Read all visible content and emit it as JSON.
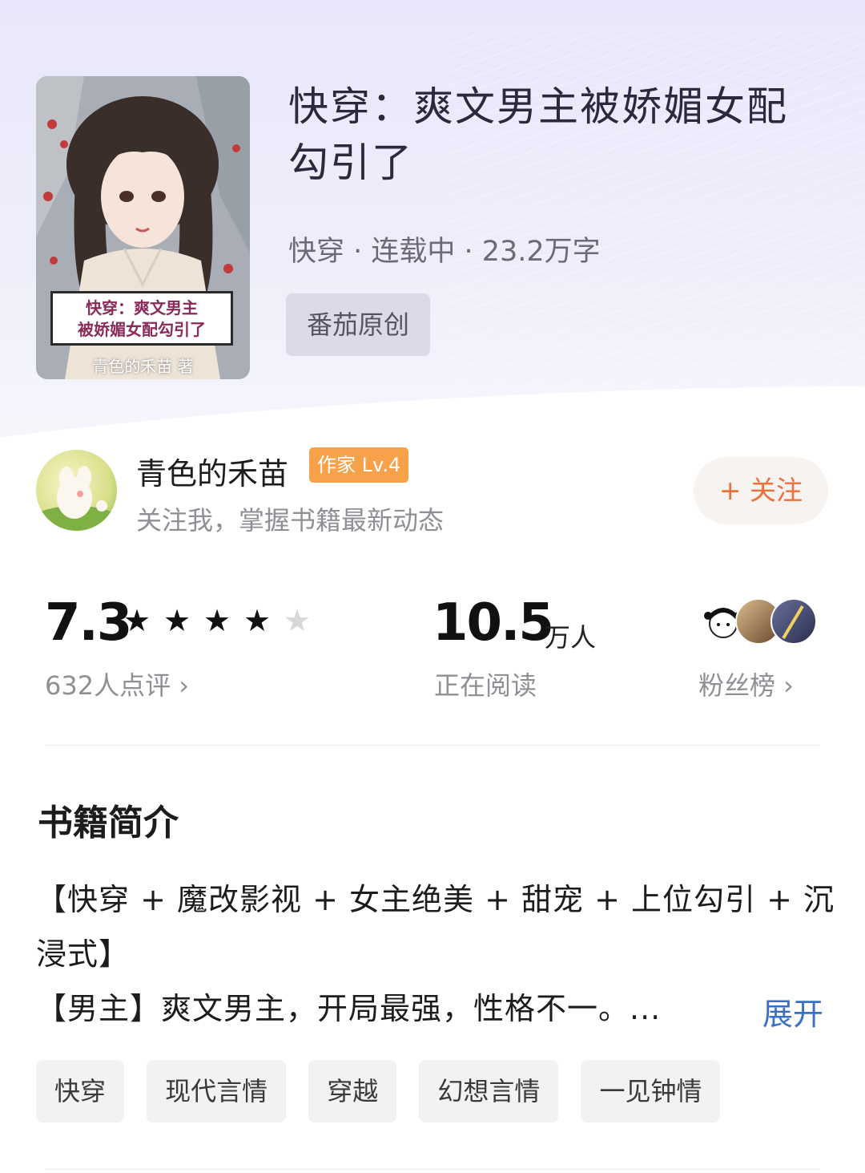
{
  "book": {
    "title": "快穿：爽文男主被娇媚女配勾引了",
    "meta": "快穿 · 连载中 · 23.2万字",
    "origin_badge": "番茄原创",
    "cover": {
      "label_line1": "快穿：爽文男主",
      "label_line2": "被娇媚女配勾引了",
      "author_text": "青色的禾苗 著"
    }
  },
  "author": {
    "name": "青色的禾苗",
    "level": "作家 Lv.4",
    "tip": "关注我，掌握书籍最新动态",
    "follow_label": "+ 关注"
  },
  "stats": {
    "rating": "7.3",
    "stars": 4,
    "star_total": 5,
    "rating_count": "632人点评 ›",
    "reading_value": "10.5",
    "reading_unit": "万人",
    "reading_label": "正在阅读",
    "fans_label": "粉丝榜 ›"
  },
  "intro": {
    "heading": "书籍简介",
    "line1": "【快穿 + 魔改影视 + 女主绝美 + 甜宠 + 上位勾引 + 沉",
    "line2": "浸式】",
    "line3": "【男主】爽文男主，开局最强，性格不一。...",
    "expand_label": "展开"
  },
  "tags": [
    "快穿",
    "现代言情",
    "穿越",
    "幻想言情",
    "一见钟情"
  ],
  "colors": {
    "accent_orange": "#f0703a",
    "level_badge": "#f7a24a",
    "link_blue": "#3a6fc6"
  }
}
